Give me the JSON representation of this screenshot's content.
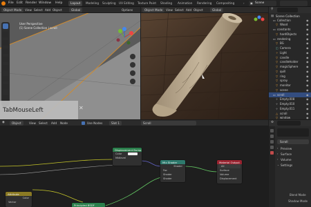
{
  "topbar": {
    "menus": [
      "File",
      "Edit",
      "Render",
      "Window",
      "Help"
    ],
    "workspaces": [
      "Layout",
      "Modeling",
      "Sculpting",
      "UV Editing",
      "Texture Paint",
      "Shading",
      "Animation",
      "Rendering",
      "Compositing"
    ],
    "active_workspace": "Layout",
    "scene": "Scene"
  },
  "viewport_left": {
    "mode": "Object Mode",
    "menus": [
      "View",
      "Select",
      "Add",
      "Object"
    ],
    "orientation": "Global",
    "options": "Options",
    "info_line1": "User Perspective",
    "info_line2": "(1) Scene Collection | scroll",
    "overlay_text": "TabMouseLeft"
  },
  "viewport_right": {
    "mode": "Object Mode",
    "menus": [
      "View",
      "Select",
      "Add",
      "Object"
    ],
    "orientation": "Global"
  },
  "outliner": {
    "title": "Scene Collection",
    "rows": [
      {
        "label": "Collection",
        "indent": 1,
        "icon": "collection-icon",
        "active": false
      },
      {
        "label": "Wood",
        "indent": 2,
        "icon": "object-icon",
        "active": false
      },
      {
        "label": "constants",
        "indent": 1,
        "icon": "collection-icon",
        "active": false
      },
      {
        "label": "hardObjects",
        "indent": 2,
        "icon": "object-icon",
        "active": false
      },
      {
        "label": "rendering",
        "indent": 1,
        "icon": "collection-icon",
        "active": false
      },
      {
        "label": "BG",
        "indent": 2,
        "icon": "object-icon",
        "active": false
      },
      {
        "label": "Camera",
        "indent": 2,
        "icon": "camera-icon",
        "active": false
      },
      {
        "label": "Light",
        "indent": 2,
        "icon": "light-icon",
        "active": false
      },
      {
        "label": "candle",
        "indent": 2,
        "icon": "object-icon",
        "active": false
      },
      {
        "label": "candleHolder",
        "indent": 2,
        "icon": "object-icon",
        "active": false
      },
      {
        "label": "magicSphere",
        "indent": 2,
        "icon": "object-icon",
        "active": false
      },
      {
        "label": "quill",
        "indent": 2,
        "icon": "object-icon",
        "active": false
      },
      {
        "label": "ring",
        "indent": 2,
        "icon": "object-icon",
        "active": false
      },
      {
        "label": "spray",
        "indent": 2,
        "icon": "object-icon",
        "active": false
      },
      {
        "label": "monitor",
        "indent": 2,
        "icon": "object-icon",
        "active": false
      },
      {
        "label": "scene",
        "indent": 2,
        "icon": "object-icon",
        "active": false
      },
      {
        "label": "scroll",
        "indent": 1,
        "icon": "collection-icon",
        "active": true
      },
      {
        "label": "Empty.008",
        "indent": 2,
        "icon": "empty-icon",
        "active": false
      },
      {
        "label": "Empty.010",
        "indent": 2,
        "icon": "empty-icon",
        "active": false
      },
      {
        "label": "Empty.011",
        "indent": 2,
        "icon": "empty-icon",
        "active": false
      },
      {
        "label": "scroll",
        "indent": 2,
        "icon": "mesh-icon",
        "active": false
      },
      {
        "label": "window",
        "indent": 2,
        "icon": "object-icon",
        "active": false
      }
    ]
  },
  "node_editor": {
    "mode": "Object",
    "menus": [
      "View",
      "Select",
      "Add",
      "Node"
    ],
    "use_nodes": "Use Nodes",
    "slot": "Slot 1",
    "material": "Scroll",
    "nodes": {
      "displacement": {
        "title": "Displacement Bump",
        "rows": [
          "Color",
          "Midlevel"
        ]
      },
      "mix_shader": {
        "title": "Mix Shader",
        "rows": [
          "Shader",
          "Fac",
          "Shader",
          "Shader"
        ]
      },
      "material_output": {
        "title": "Material Output",
        "rows": [
          "All",
          "Surface",
          "Volume",
          "Displacement"
        ]
      },
      "yellow_node": {
        "title": "Attribute",
        "rows": [
          "Color",
          "Vector"
        ]
      },
      "green_node": {
        "title": "Principled BSDF",
        "rows": []
      }
    }
  },
  "properties": {
    "material_name": "Scroll",
    "sections": [
      "Preview",
      "Surface",
      "Volume",
      "Settings"
    ],
    "blend_mode": "Blend Mode",
    "shadow_mode": "Shadow Mode"
  },
  "colors": {
    "accent_blue": "#4772b3",
    "node_green": "#2b7f4c",
    "node_red": "#9a2330",
    "node_yellow": "#8b7a24",
    "node_teal": "#2e7a6d"
  }
}
